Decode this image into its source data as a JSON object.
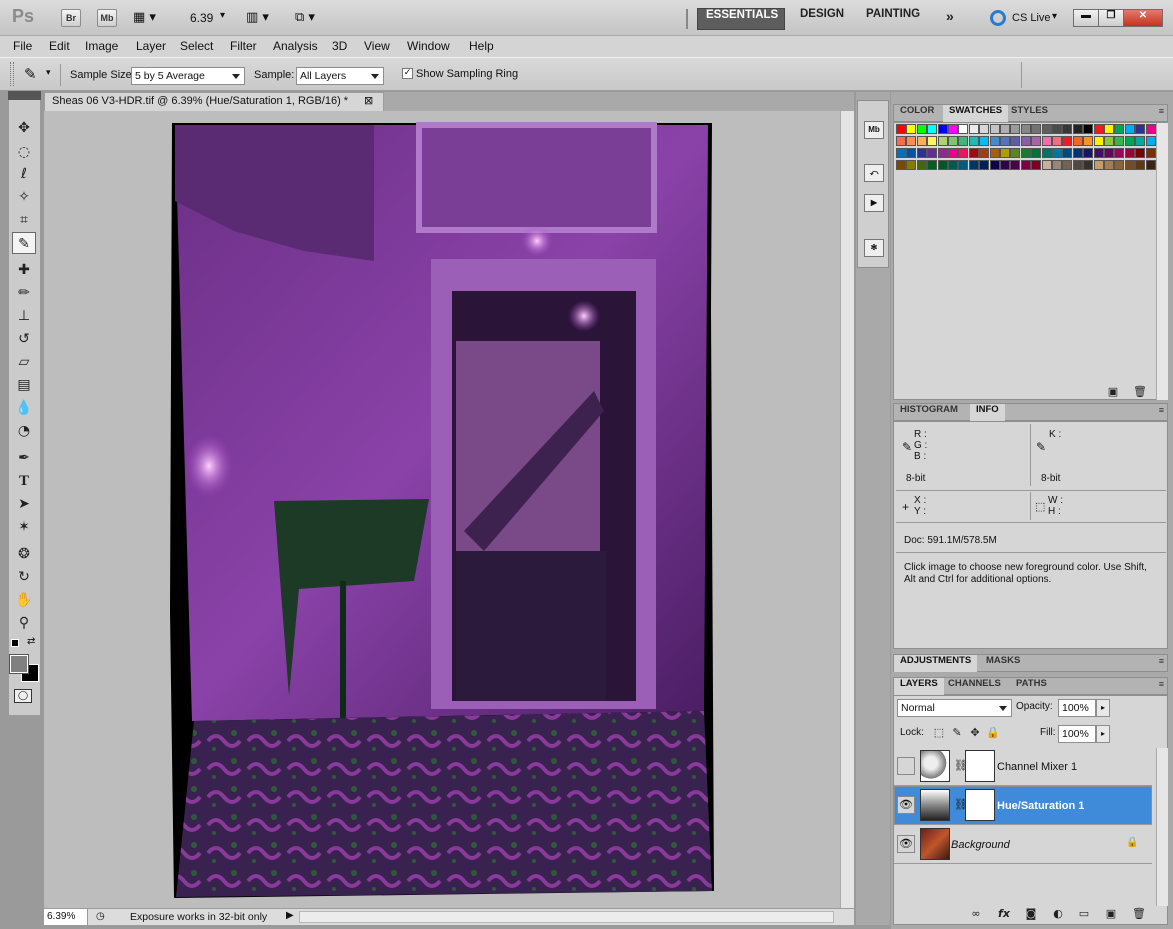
{
  "app": {
    "logo": "Ps",
    "bridge_button": "Br",
    "minibridge_button": "Mb",
    "zoom_value": "6.39",
    "workspaces": [
      "ESSENTIALS",
      "DESIGN",
      "PAINTING"
    ],
    "more_workspaces": "»",
    "cs_live": "CS Live"
  },
  "menu": [
    "File",
    "Edit",
    "Image",
    "Layer",
    "Select",
    "Filter",
    "Analysis",
    "3D",
    "View",
    "Window",
    "Help"
  ],
  "options": {
    "sample_size_label": "Sample Size:",
    "sample_size_value": "5 by 5 Average",
    "sample_label": "Sample:",
    "sample_value": "All Layers",
    "show_ring_label": "Show Sampling Ring",
    "show_ring_checked": true
  },
  "document": {
    "tab_title": "Sheas 06 V3-HDR.tif @ 6.39% (Hue/Saturation 1, RGB/16) *",
    "close_glyph": "⊠",
    "zoom_status": "6.39%",
    "status_text": "Exposure works in 32-bit only"
  },
  "swatches_panel": {
    "tabs": [
      "COLOR",
      "SWATCHES",
      "STYLES"
    ],
    "active_tab": "SWATCHES",
    "rows": [
      [
        "#ff0000",
        "#ffff00",
        "#00ff00",
        "#00ffff",
        "#0000ff",
        "#ff00ff",
        "#ffffff",
        "#ebebeb",
        "#d7d7d7",
        "#c3c3c3",
        "#afafaf",
        "#9b9b9b",
        "#878787",
        "#737373",
        "#5f5f5f",
        "#4b4b4b",
        "#373737",
        "#232323",
        "#000000",
        "#ed1c24",
        "#fff200",
        "#00a651",
        "#00aeef",
        "#2e3192",
        "#ec008c"
      ],
      [
        "#f26c4f",
        "#f68e56",
        "#fbaf5c",
        "#fff467",
        "#acd372",
        "#7dc473",
        "#3cb878",
        "#1cbbb4",
        "#00bff3",
        "#438ccb",
        "#5574b9",
        "#605ca8",
        "#855fa8",
        "#a763a8",
        "#f06ea9",
        "#f26d7d",
        "#ed1c24",
        "#f26522",
        "#f7941d",
        "#fff200",
        "#8dc63f",
        "#39b54a",
        "#00a651",
        "#00a99d",
        "#00aeef"
      ],
      [
        "#0072bc",
        "#0054a6",
        "#2e3192",
        "#662d91",
        "#92278f",
        "#ec008c",
        "#ed145b",
        "#9e0b0f",
        "#a0410d",
        "#a3620a",
        "#aba000",
        "#598527",
        "#197b30",
        "#007236",
        "#00746b",
        "#0076a3",
        "#004b80",
        "#003471",
        "#1b1464",
        "#440e62",
        "#630460",
        "#9e005d",
        "#9e0039",
        "#790000",
        "#7b2e00"
      ],
      [
        "#7d4900",
        "#827b00",
        "#406618",
        "#005e20",
        "#005826",
        "#005952",
        "#005b7f",
        "#003663",
        "#002157",
        "#0d004c",
        "#32004b",
        "#4b0049",
        "#7b0046",
        "#7a0026",
        "#c7b299",
        "#998675",
        "#736357",
        "#534741",
        "#37302d",
        "#c69c6d",
        "#a67c52",
        "#8c6239",
        "#754c24",
        "#603913",
        "#3c2415"
      ]
    ]
  },
  "info_panel": {
    "tabs": [
      "HISTOGRAM",
      "INFO"
    ],
    "active_tab": "INFO",
    "r_label": "R :",
    "g_label": "G :",
    "b_label": "B :",
    "k_label": "K :",
    "bits_left": "8-bit",
    "bits_right": "8-bit",
    "x_label": "X :",
    "y_label": "Y :",
    "w_label": "W :",
    "h_label": "H :",
    "doc_size": "Doc: 591.1M/578.5M",
    "hint": "Click image to choose new foreground color.  Use Shift, Alt and Ctrl for additional options."
  },
  "adjust_panel": {
    "tabs": [
      "ADJUSTMENTS",
      "MASKS"
    ],
    "active_tab": "ADJUSTMENTS"
  },
  "layers_panel": {
    "tabs": [
      "LAYERS",
      "CHANNELS",
      "PATHS"
    ],
    "active_tab": "LAYERS",
    "blend_mode": "Normal",
    "opacity_label": "Opacity:",
    "opacity_value": "100%",
    "lock_label": "Lock:",
    "fill_label": "Fill:",
    "fill_value": "100%",
    "layers": [
      {
        "name": "Channel Mixer 1",
        "visible": false,
        "selected": false
      },
      {
        "name": "Hue/Saturation 1",
        "visible": true,
        "selected": true
      },
      {
        "name": "Background",
        "visible": true,
        "selected": false,
        "locked": true
      }
    ],
    "footer_icons": [
      "link-icon",
      "fx-icon",
      "mask-icon",
      "adjustment-icon",
      "folder-icon",
      "new-layer-icon",
      "trash-icon"
    ]
  },
  "colors": {
    "selected_layer": "#3f8bd9",
    "active_workspace": "#5d5d5d",
    "foreground": "#808080",
    "background": "#000000"
  }
}
